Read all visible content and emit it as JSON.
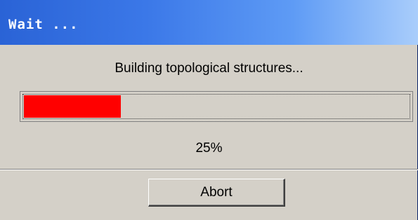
{
  "window": {
    "title": "Wait ...",
    "message": "Building topological structures...",
    "progress": {
      "fraction": 0.25,
      "label": "25%",
      "fill_color": "#ff0000"
    },
    "abort_label": "Abort"
  }
}
